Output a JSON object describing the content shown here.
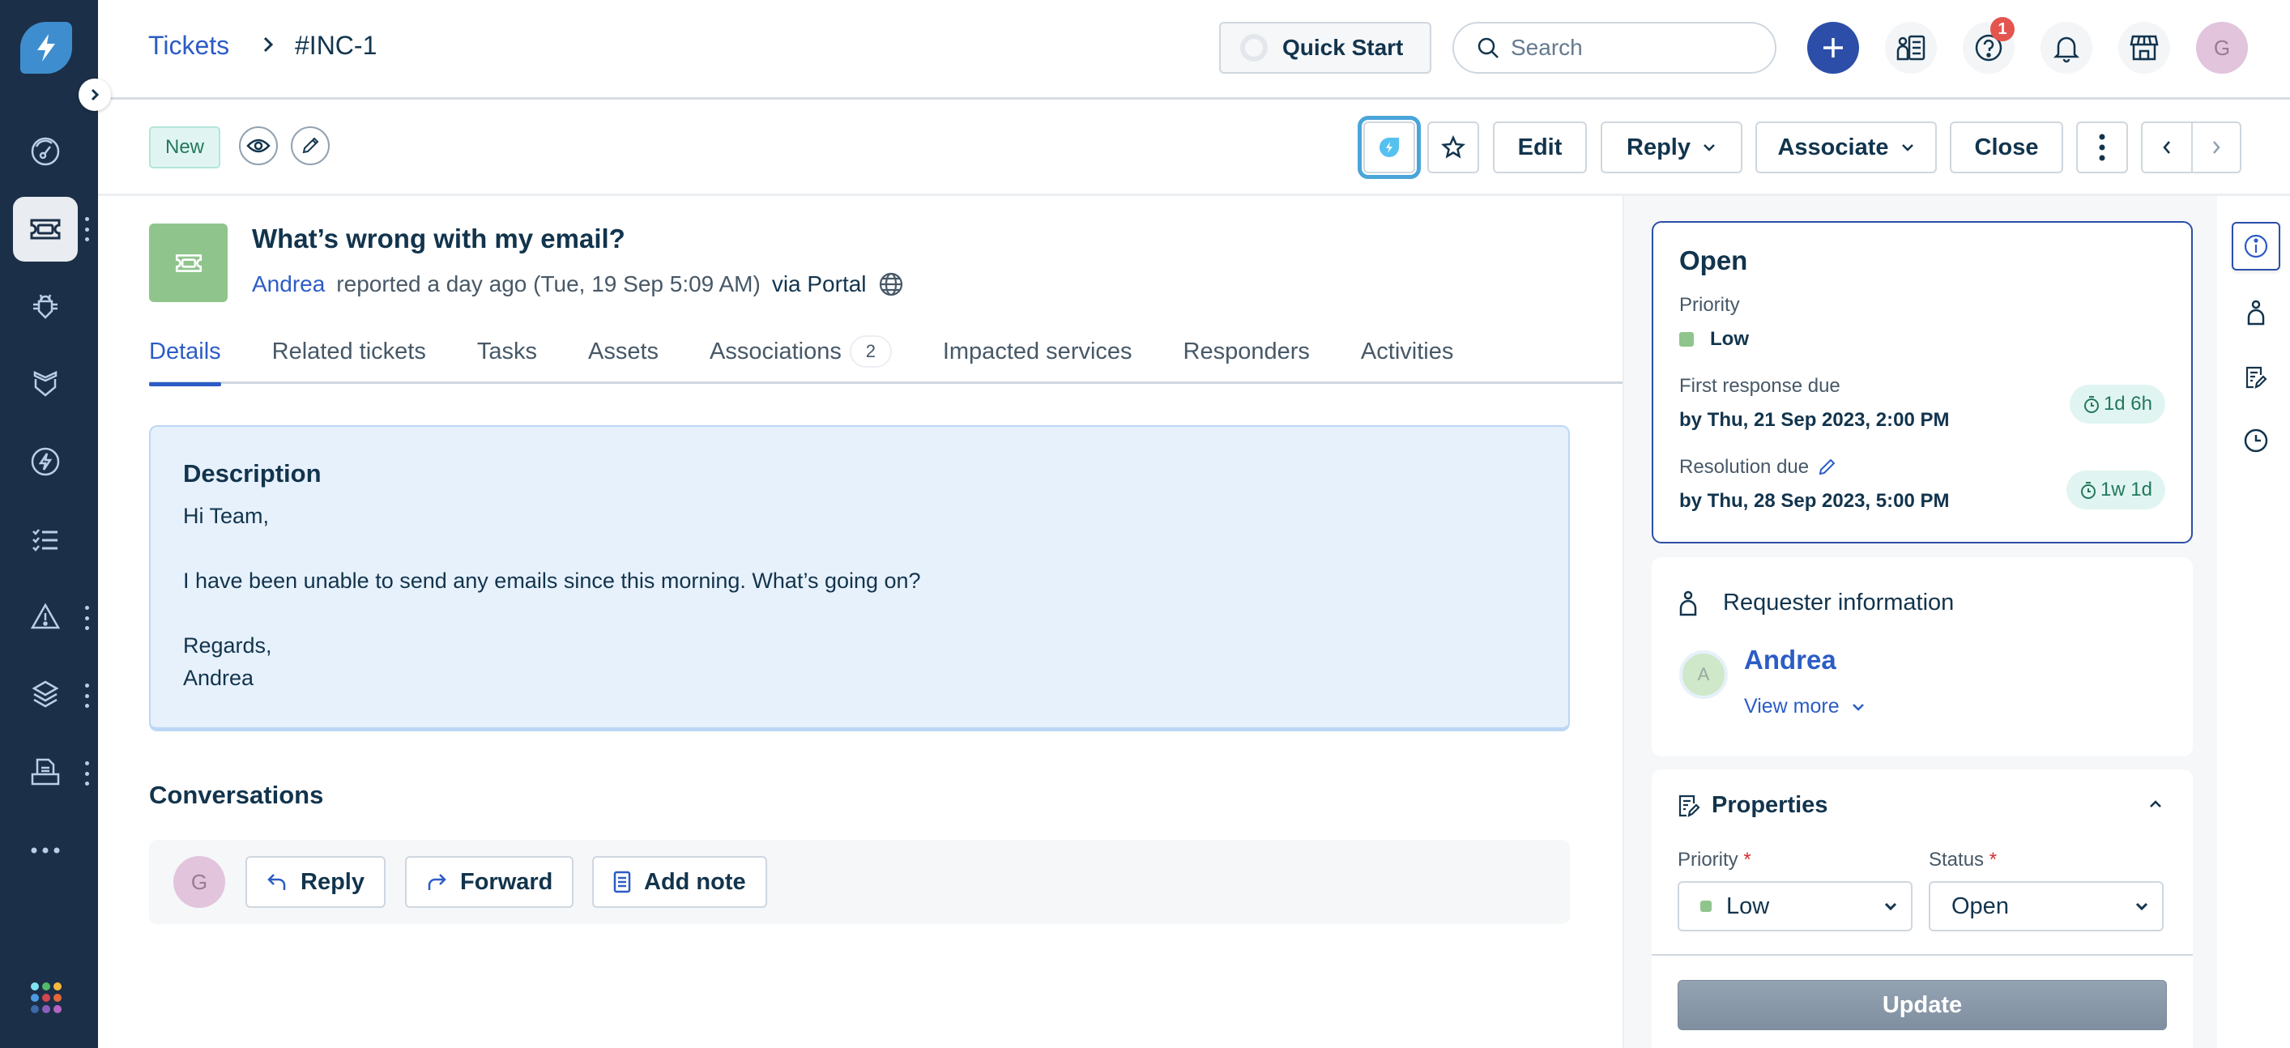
{
  "breadcrumb": {
    "parent": "Tickets",
    "current": "#INC-1"
  },
  "header": {
    "quick_start": "Quick Start",
    "search_placeholder": "Search",
    "help_badge": "1",
    "avatar_initial": "G"
  },
  "sidebar": {
    "items": [
      {
        "name": "dashboard",
        "icon": "gauge-icon"
      },
      {
        "name": "tickets",
        "icon": "ticket-icon",
        "active": true
      },
      {
        "name": "problems",
        "icon": "bug-icon"
      },
      {
        "name": "changes",
        "icon": "shield-icon"
      },
      {
        "name": "releases",
        "icon": "bolt-icon"
      },
      {
        "name": "tasks",
        "icon": "checklist-icon"
      },
      {
        "name": "alerts",
        "icon": "warning-icon"
      },
      {
        "name": "assets",
        "icon": "layers-icon"
      },
      {
        "name": "solutions",
        "icon": "document-tray-icon"
      },
      {
        "name": "more",
        "icon": "more-horizontal-icon"
      }
    ],
    "app_dot_colors": [
      "#7fe3ef",
      "#55b96a",
      "#f5b83d",
      "#4d9be2",
      "#d4464e",
      "#e4683a",
      "#3d6aa8",
      "#8f5ebd",
      "#b565c4"
    ]
  },
  "actionbar": {
    "status_tag": "New",
    "edit": "Edit",
    "reply": "Reply",
    "associate": "Associate",
    "close": "Close"
  },
  "ticket": {
    "subject": "What’s wrong with my email?",
    "requester": "Andrea",
    "reported": "reported a day ago (Tue, 19 Sep 5:09 AM)",
    "via": "via Portal",
    "ticket_icon_color": "#8fc58c"
  },
  "tabs": [
    {
      "label": "Details",
      "active": true
    },
    {
      "label": "Related tickets"
    },
    {
      "label": "Tasks"
    },
    {
      "label": "Assets"
    },
    {
      "label": "Associations",
      "count": "2"
    },
    {
      "label": "Impacted services"
    },
    {
      "label": "Responders"
    },
    {
      "label": "Activities"
    }
  ],
  "description": {
    "title": "Description",
    "lines": [
      "Hi Team,",
      "I have been unable to send any emails since this morning. What’s going on?",
      "Regards,",
      "Andrea"
    ]
  },
  "conversations": {
    "title": "Conversations",
    "avatar_initial": "G",
    "reply": "Reply",
    "forward": "Forward",
    "add_note": "Add note"
  },
  "status_card": {
    "status": "Open",
    "priority_label": "Priority",
    "priority_value": "Low",
    "priority_color": "#8fc58c",
    "first_response_label": "First response due",
    "first_response_value": "by Thu, 21 Sep 2023, 2:00 PM",
    "first_response_chip": "1d 6h",
    "resolution_label": "Resolution due",
    "resolution_value": "by Thu, 28 Sep 2023, 5:00 PM",
    "resolution_chip": "1w 1d"
  },
  "requester_card": {
    "title": "Requester information",
    "avatar_initial": "A",
    "name": "Andrea",
    "view_more": "View more"
  },
  "properties": {
    "title": "Properties",
    "priority_label": "Priority",
    "priority_value": "Low",
    "status_label": "Status",
    "status_value": "Open",
    "required_mark": "*",
    "update": "Update"
  }
}
